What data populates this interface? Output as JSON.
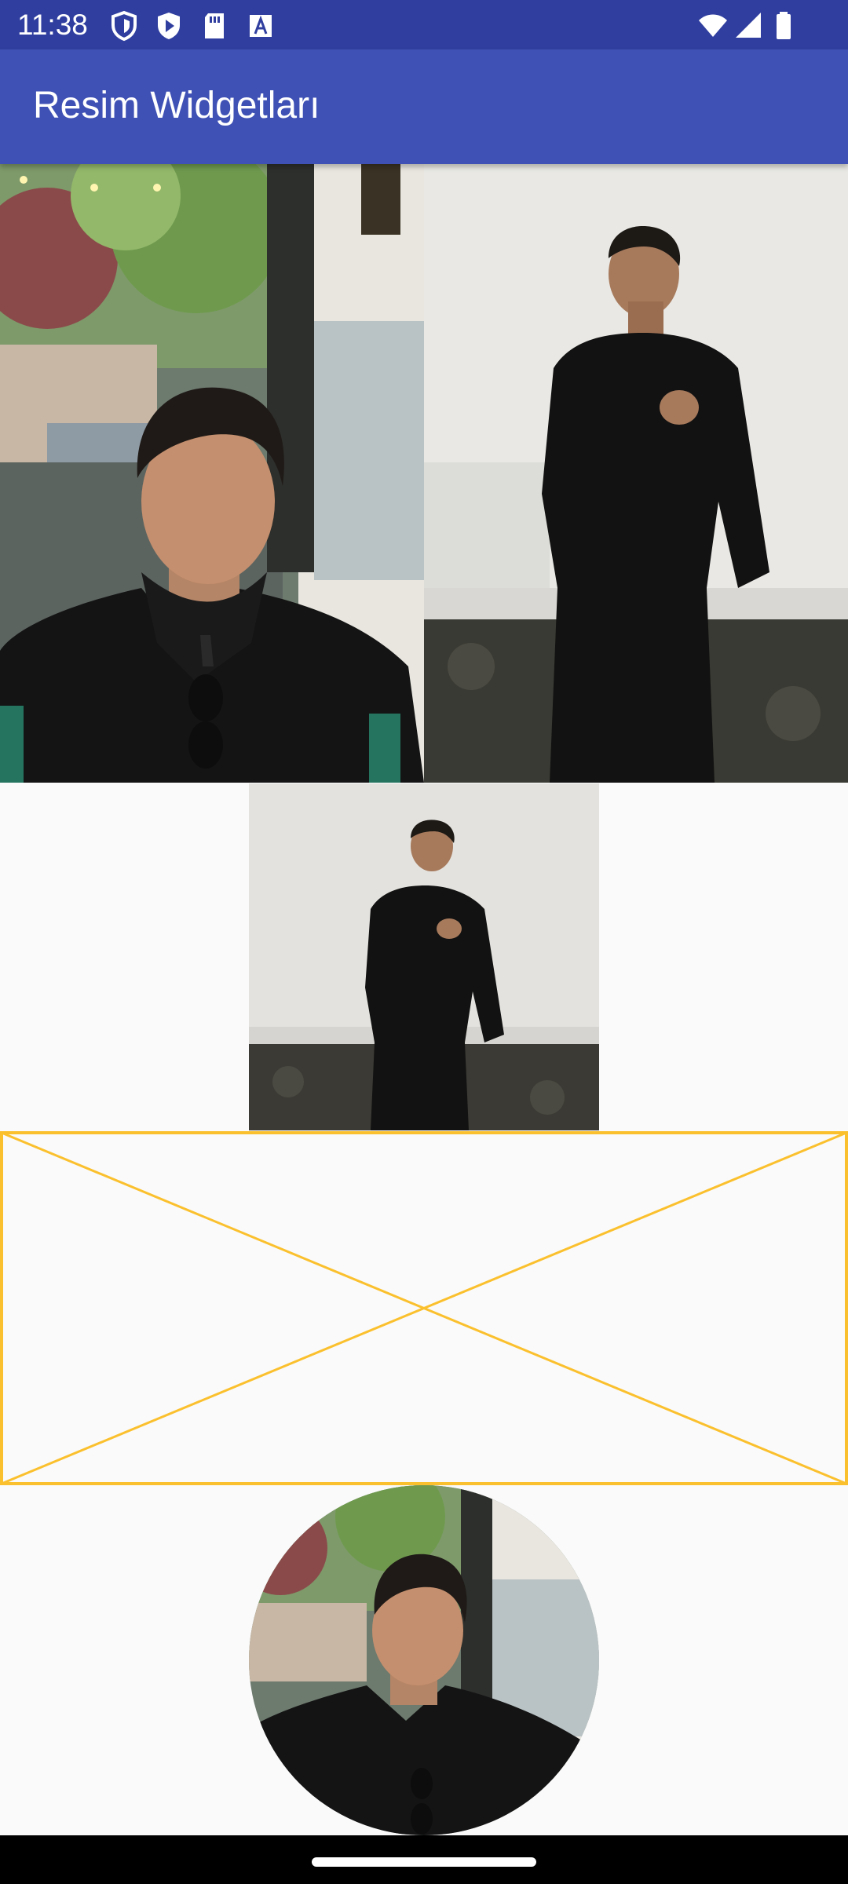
{
  "status_bar": {
    "time": "11:38",
    "left_icons": [
      "shield-icon",
      "play-store-icon",
      "sd-card-icon",
      "text-a-icon"
    ],
    "right_icons": [
      "wifi-icon",
      "cellular-signal-icon",
      "battery-icon"
    ]
  },
  "app_bar": {
    "title": "Resim Widgetları"
  },
  "colors": {
    "status_bar": "#303f9f",
    "app_bar": "#3f51b5",
    "background": "#fafafa",
    "placeholder_stroke": "#fbc02d"
  },
  "images": [
    {
      "name": "photo-man-cafe",
      "kind": "image"
    },
    {
      "name": "photo-man-wall",
      "kind": "image"
    },
    {
      "name": "photo-man-wall-small",
      "kind": "image"
    },
    {
      "name": "placeholder",
      "kind": "placeholder"
    },
    {
      "name": "circle-avatar",
      "kind": "circle-avatar"
    }
  ]
}
